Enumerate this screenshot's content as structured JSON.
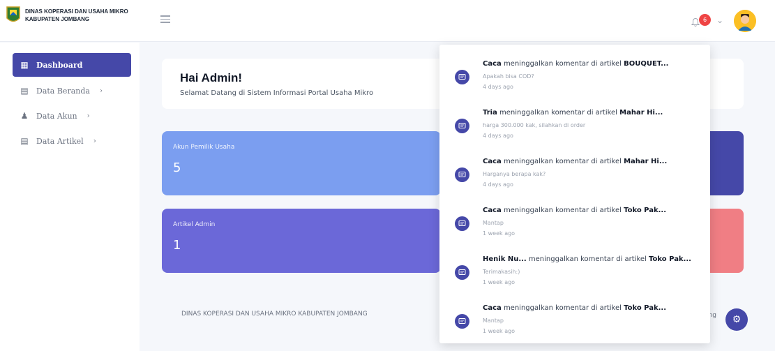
{
  "header": {
    "brand_line1": "DINAS KOPERASI DAN USAHA MIKRO",
    "brand_line2": "KABUPATEN JOMBANG",
    "notification_count": "6"
  },
  "sidebar": {
    "items": [
      {
        "label": "Dashboard",
        "icon": "grid-icon"
      },
      {
        "label": "Data Beranda",
        "icon": "file-icon"
      },
      {
        "label": "Data Akun",
        "icon": "user-icon"
      },
      {
        "label": "Data Artikel",
        "icon": "file-icon"
      }
    ]
  },
  "main": {
    "greeting": "Hai Admin!",
    "subtitle": "Selamat Datang di Sistem Informasi Portal Usaha Mikro",
    "cards": [
      {
        "label": "Akun Pemilik Usaha",
        "value": "5"
      },
      {
        "label": "Artikel Admin",
        "value": "1"
      }
    ],
    "footer_text": "DINAS KOPERASI DAN USAHA MIKRO KABUPATEN JOMBANG",
    "footer_right_fragment": "ang"
  },
  "notifications": [
    {
      "user": "Caca",
      "action": " meninggalkan komentar di artikel ",
      "article": "BOUQUET...",
      "message": "Apakah bisa COD?",
      "time": "4 days ago"
    },
    {
      "user": "Tria",
      "action": " meninggalkan komentar di artikel ",
      "article": "Mahar Hi...",
      "message": "harga 300.000 kak, silahkan di order",
      "time": "4 days ago"
    },
    {
      "user": "Caca",
      "action": " meninggalkan komentar di artikel ",
      "article": "Mahar Hi...",
      "message": "Harganya berapa kak?",
      "time": "4 days ago"
    },
    {
      "user": "Caca",
      "action": " meninggalkan komentar di artikel ",
      "article": "Toko Pak...",
      "message": "Mantap",
      "time": "1 week ago"
    },
    {
      "user": "Henik Nu...",
      "action": " meninggalkan komentar di artikel ",
      "article": "Toko Pak...",
      "message": "Terimakasih:)",
      "time": "1 week ago"
    },
    {
      "user": "Caca",
      "action": " meninggalkan komentar di artikel ",
      "article": "Toko Pak...",
      "message": "Mantap",
      "time": "1 week ago"
    }
  ],
  "colors": {
    "accent": "#4548a8",
    "card_blue": "#7b9ef0",
    "card_purple": "#6b68d8",
    "card_red": "#f07e84",
    "badge": "#ef4444"
  }
}
